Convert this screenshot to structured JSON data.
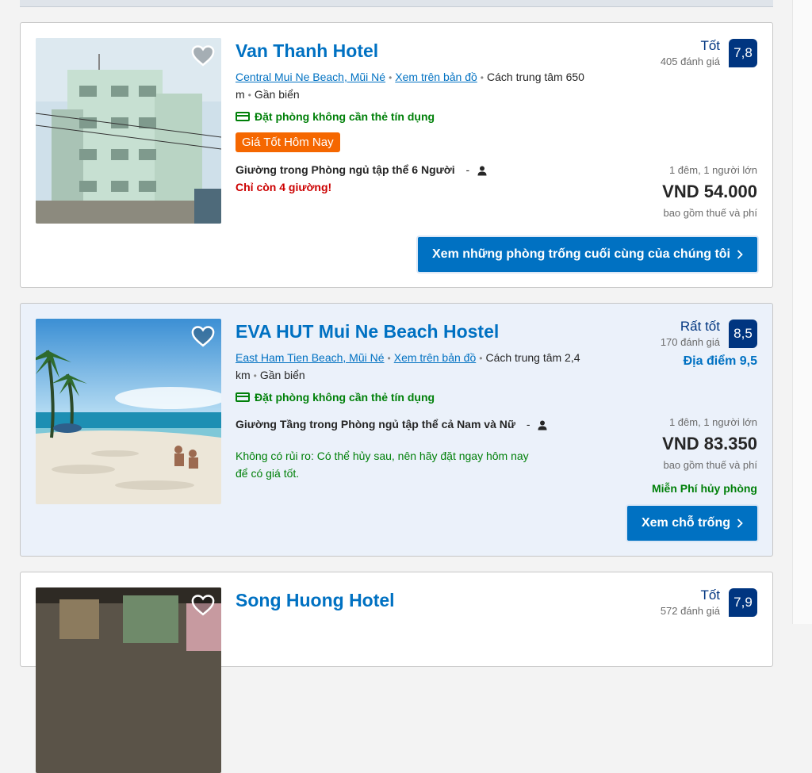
{
  "hotels": [
    {
      "name": "Van Thanh Hotel",
      "area_link": "Central Mui Ne Beach, Mũi Né",
      "map_link": "Xem trên bản đồ",
      "distance": "Cách trung tâm 650 m",
      "beach": "Gần biển",
      "no_card": "Đặt phòng không cần thẻ tín dụng",
      "deal_badge": "Giá Tốt Hôm Nay",
      "room_type": "Giường trong Phòng ngủ tập thể 6 Người",
      "room_sep": "-",
      "scarcity": "Chỉ còn 4 giường!",
      "score_word": "Tốt",
      "reviews": "405 đánh giá",
      "score": "7,8",
      "nights_guests": "1 đêm, 1 người lớn",
      "price": "VND 54.000",
      "taxes": "bao gồm thuế và phí",
      "button": "Xem những phòng trống cuối cùng của chúng tôi"
    },
    {
      "name": "EVA HUT Mui Ne Beach Hostel",
      "area_link": "East Ham Tien Beach, Mũi Né",
      "map_link": "Xem trên bản đồ",
      "distance": "Cách trung tâm 2,4 km",
      "beach": "Gần biển",
      "no_card": "Đặt phòng không cần thẻ tín dụng",
      "room_type": "Giường Tầng trong Phòng ngủ tập thể cả Nam và Nữ",
      "room_sep": "-",
      "risk_free": "Không có rủi ro: Có thể hủy sau, nên hãy đặt ngay hôm nay để có giá tốt.",
      "score_word": "Rất tốt",
      "reviews": "170 đánh giá",
      "score": "8,5",
      "location_score": "Địa điểm 9,5",
      "nights_guests": "1 đêm, 1 người lớn",
      "price": "VND 83.350",
      "taxes": "bao gồm thuế và phí",
      "free_cancel": "Miễn Phí hủy phòng",
      "button": "Xem chỗ trống"
    },
    {
      "name": "Song Huong Hotel",
      "score_word": "Tốt",
      "reviews": "572 đánh giá",
      "score": "7,9"
    }
  ],
  "colors": {
    "link": "#0071c2",
    "score_badge": "#003580",
    "green": "#008009",
    "deal": "#f56700",
    "warning": "#cc0000"
  },
  "icons": [
    "heart-icon",
    "credit-card-icon",
    "person-icon",
    "chevron-right-icon"
  ]
}
